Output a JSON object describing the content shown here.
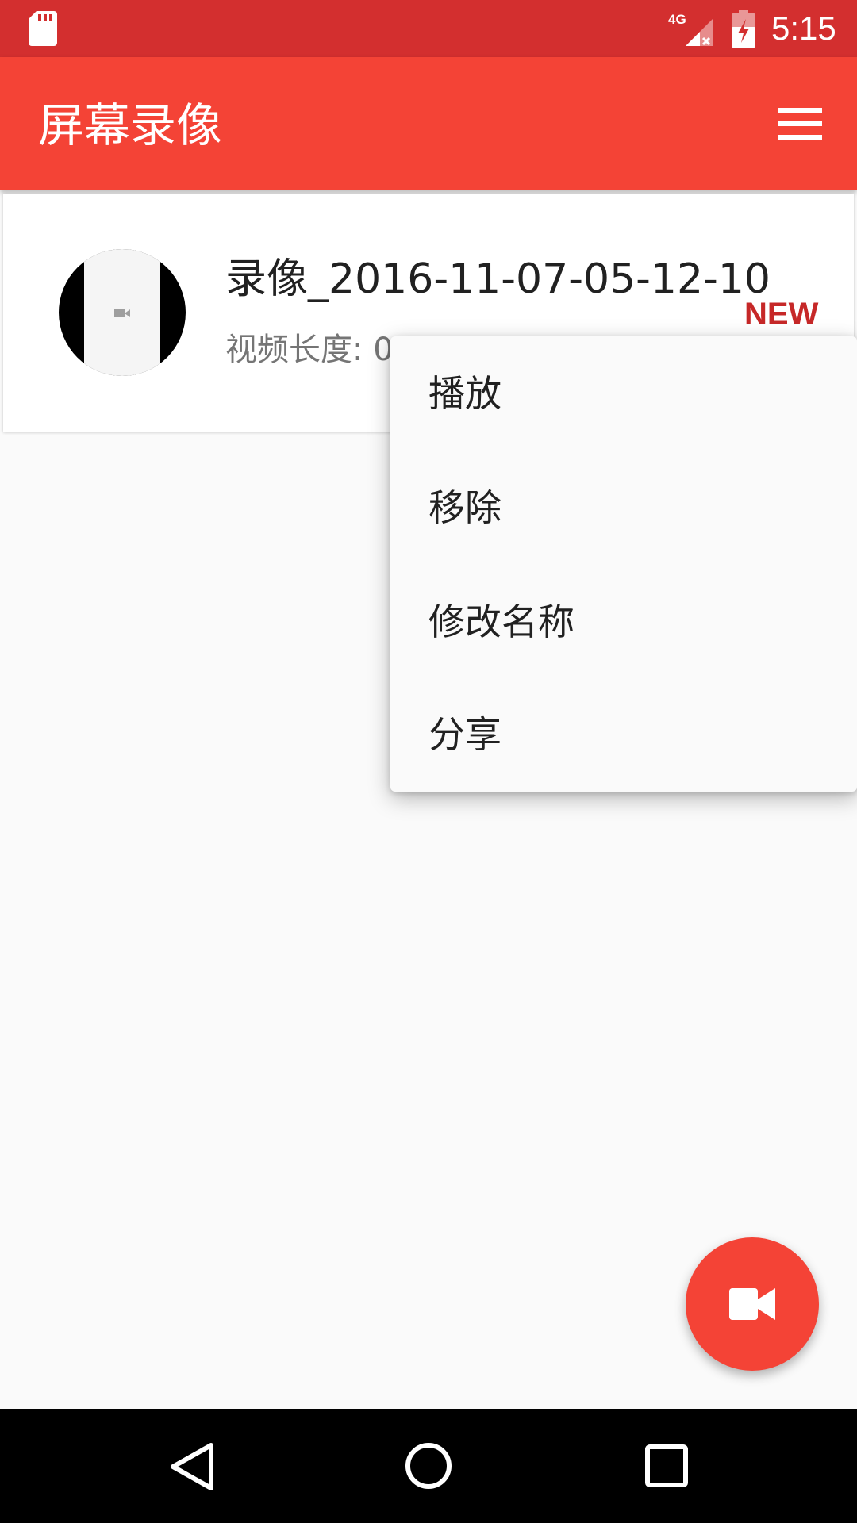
{
  "status_bar": {
    "network_label": "4G",
    "time": "5:15",
    "icons": [
      "sd-card-icon",
      "signal-icon",
      "battery-charging-icon"
    ]
  },
  "app_bar": {
    "title": "屏幕录像",
    "menu_icon": "hamburger-menu-icon"
  },
  "recording": {
    "title": "录像_2016-11-07-05-12-10",
    "duration_label": "视频长度: 0",
    "badge": "NEW"
  },
  "context_menu": {
    "items": [
      {
        "label": "播放"
      },
      {
        "label": "移除"
      },
      {
        "label": "修改名称"
      },
      {
        "label": "分享"
      }
    ]
  },
  "fab": {
    "icon": "video-camera-icon"
  },
  "nav_bar": {
    "icons": [
      "back-icon",
      "home-icon",
      "recents-icon"
    ]
  },
  "colors": {
    "status_bar": "#d32f2f",
    "app_bar": "#f44336",
    "accent": "#f44336",
    "badge": "#c62828",
    "background": "#fafafa"
  }
}
